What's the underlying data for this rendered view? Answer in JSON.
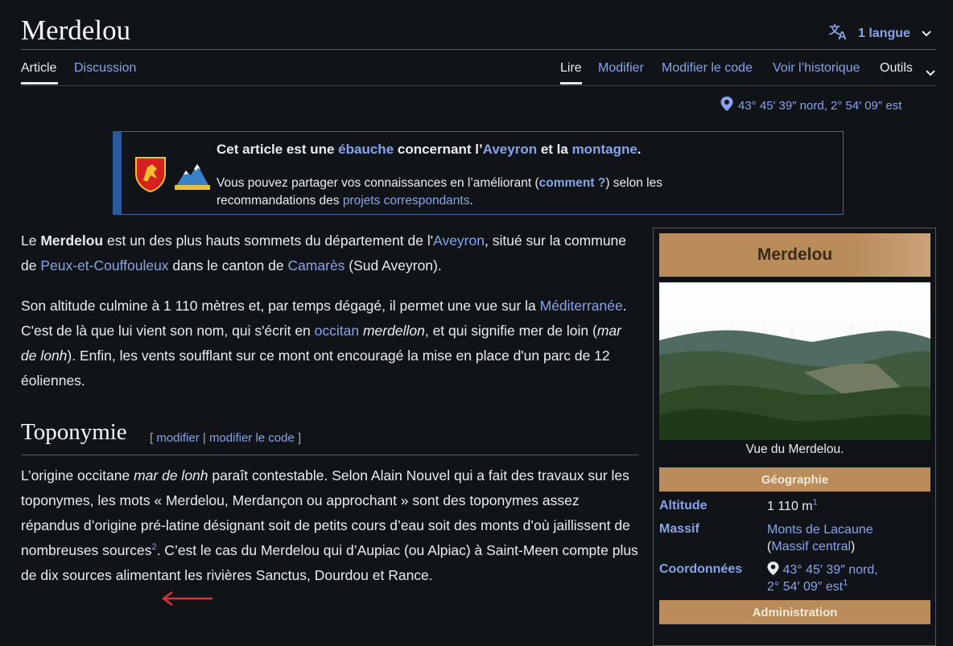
{
  "page": {
    "title": "Merdelou"
  },
  "lang": {
    "label": "1 langue"
  },
  "tabs": {
    "article": "Article",
    "discussion": "Discussion",
    "lire": "Lire",
    "modifier": "Modifier",
    "modifier_code": "Modifier le code",
    "historique": "Voir l’historique",
    "outils": "Outils"
  },
  "coords": {
    "top": "43° 45′ 39″ nord, 2° 54′ 09″ est"
  },
  "ambox": {
    "t1": "Cet article est une ",
    "t2": "ébauche",
    "t3": " concernant l’",
    "t4": "Aveyron",
    "t5": " et la ",
    "t6": "montagne",
    "t7": ".",
    "b1": "Vous pouvez partager vos connaissances en l’améliorant (",
    "b2": "comment ?",
    "b3": ") selon les recommandations des ",
    "b4": "projets correspondants",
    "b5": "."
  },
  "p1": {
    "a": "Le ",
    "b": "Merdelou",
    "c": " est un des plus hauts sommets du département de l'",
    "d": "Aveyron",
    "e": ", situé sur la commune de ",
    "f": "Peux-et-Couffouleux",
    "g": " dans le canton de ",
    "h": "Camarès",
    "i": " (Sud Aveyron)."
  },
  "p2": {
    "a": "Son altitude culmine à 1 110 mètres et, par temps dégagé, il permet une vue sur la ",
    "b": "Méditerranée",
    "c": ". C'est de là que lui vient son nom, qui s'écrit en ",
    "d": "occitan",
    "e": " ",
    "f": "merdellon",
    "g": ", et qui signifie mer de loin (",
    "h": "mar de lonh",
    "i": "). Enfin, les vents soufflant sur ce mont ont encouragé la mise en place d'un parc de 12 éoliennes."
  },
  "section": {
    "title": "Toponymie",
    "ob": "[ ",
    "edit": "modifier",
    "sep": " | ",
    "edit_code": "modifier le code",
    "cb": " ]"
  },
  "p3": {
    "a": "L’origine occitane ",
    "b": "mar de lonh",
    "c": " paraît contestable. Selon Alain Nouvel qui a fait des travaux sur les toponymes, les mots « Merdelou, Merdançon ou approchant » sont des toponymes assez répandus d’origine pré-latine désignant soit de petits cours d’eau soit des monts d’où jaillissent de nombreuses sources",
    "ref": "2",
    "d": ". C’est le cas du Merdelou qui d’Aupiac (ou Alpiac) à Saint-Meen compte plus de dix sources alimentant les rivières Sanctus, Dourdou et Rance."
  },
  "infobox": {
    "title": "Merdelou",
    "caption": "Vue du Merdelou.",
    "sec_geo": "Géographie",
    "alt_label": "Altitude",
    "alt_value": "1 110 m",
    "alt_ref": "1",
    "massif_label": "Massif",
    "massif_value": "Monts de Lacaune",
    "massif_ob": "(",
    "massif_sub": "Massif central",
    "massif_cb": ")",
    "coord_label": "Coordonnées",
    "coord_l1": "43° 45′ 39″ nord,",
    "coord_l2": "2° 54′ 09″ est",
    "coord_ref": "1",
    "sec_admin": "Administration"
  },
  "colors": {
    "background": "#101418",
    "link": "#88a3e8",
    "infobox_accent": "#b98c59",
    "arrow": "#d33"
  }
}
